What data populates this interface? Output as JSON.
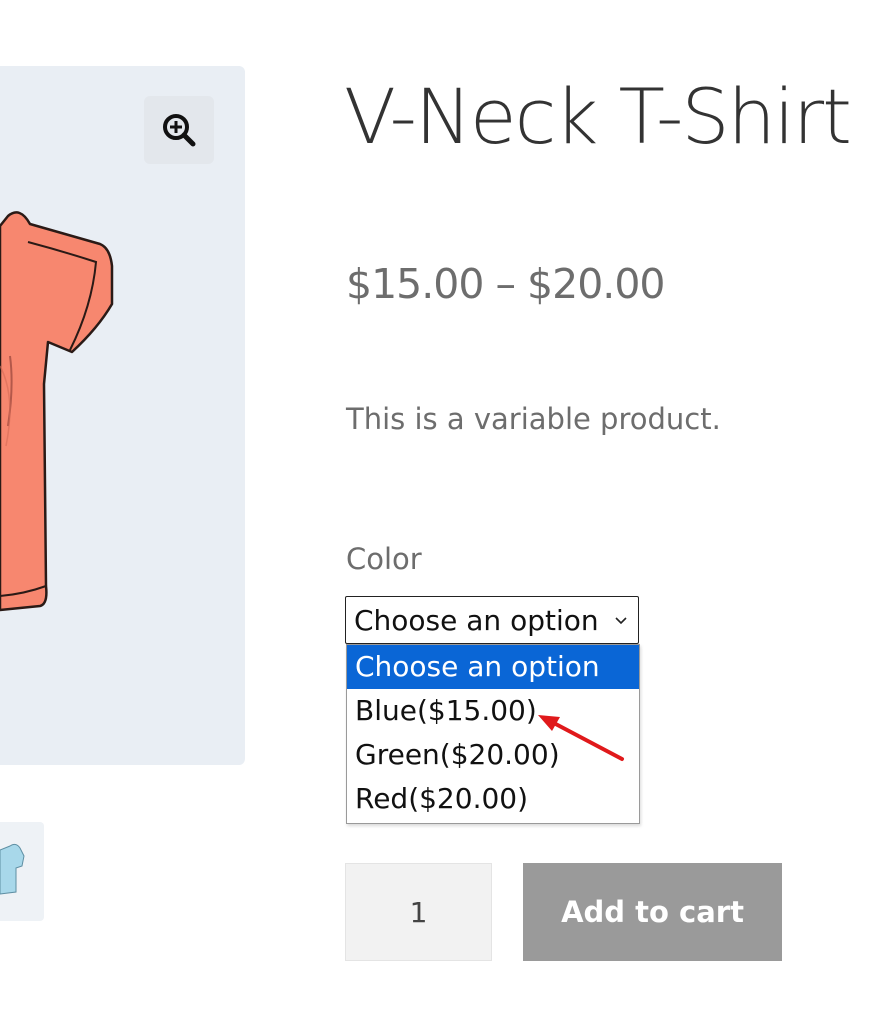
{
  "product": {
    "title": "V-Neck T-Shirt",
    "price": "$15.00 – $20.00",
    "description": "This is a variable product."
  },
  "variation": {
    "label": "Color",
    "selected": "Choose an option",
    "options": [
      "Choose an option",
      "Blue($15.00)",
      "Green($20.00)",
      "Red($20.00)"
    ],
    "highlighted_index": 0
  },
  "cart": {
    "quantity": "1",
    "button_label": "Add to cart"
  },
  "gallery": {
    "zoom_icon": "zoom-in-icon",
    "main_image": "t-shirt-image",
    "thumbnail": "t-shirt-thumbnail"
  },
  "colors": {
    "gallery_bg": "#e9eef4",
    "shirt": "#f7876f",
    "option_highlight": "#0a66d6",
    "button_bg": "#9a9a9a",
    "arrow": "#e0191b"
  }
}
